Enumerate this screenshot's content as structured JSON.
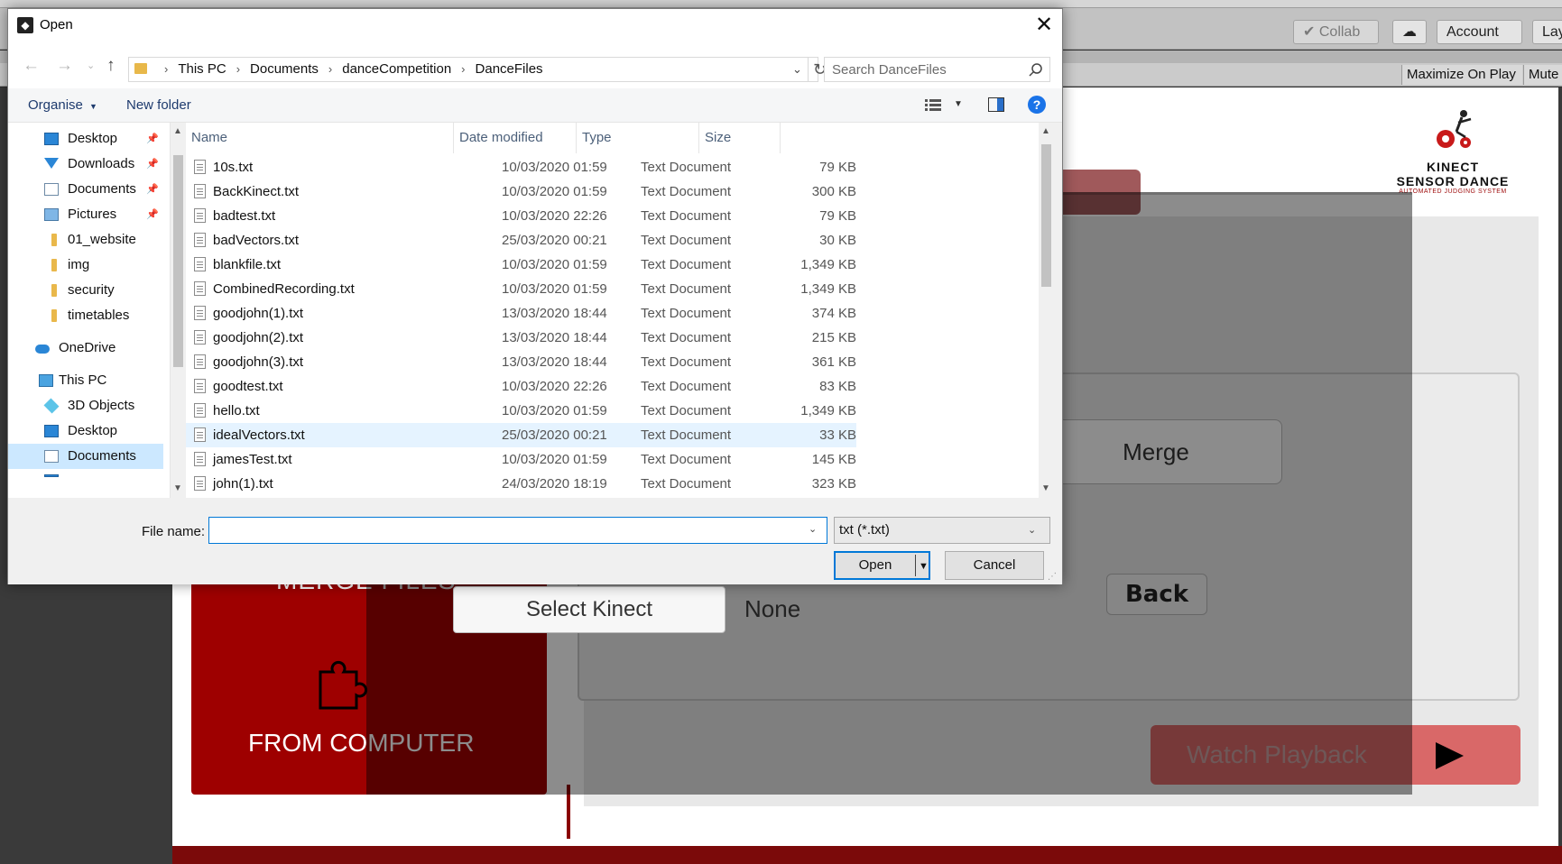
{
  "background": {
    "toolbar": {
      "collab_label": "Collab",
      "account_label": "Account",
      "layout_label": "Lay"
    },
    "game_bar": {
      "maximize_label": "Maximize On Play",
      "mute_label": "Mute"
    },
    "game": {
      "logo_title_line1": "KINECT",
      "logo_title_line2": "SENSOR DANCE",
      "logo_subtitle": "AUTOMATED JUDGING SYSTEM",
      "merge_button": "Merge",
      "back_button": "Back",
      "select_kinect_button": "Select Kinect",
      "select_kinect_value": "None",
      "merge_files_label": "MERGE FILES",
      "from_computer_label": "FROM COMPUTER",
      "watch_playback_button": "Watch Playback"
    }
  },
  "dialog": {
    "title": "Open",
    "breadcrumb": [
      "This PC",
      "Documents",
      "danceCompetition",
      "DanceFiles"
    ],
    "search_placeholder": "Search DanceFiles",
    "commands": {
      "organise_label": "Organise",
      "new_folder_label": "New folder"
    },
    "nav_items": [
      {
        "label": "Desktop",
        "icon": "desktop-icon",
        "pinned": true
      },
      {
        "label": "Downloads",
        "icon": "download-icon",
        "pinned": true
      },
      {
        "label": "Documents",
        "icon": "documents-icon",
        "pinned": true
      },
      {
        "label": "Pictures",
        "icon": "pictures-icon",
        "pinned": true
      },
      {
        "label": "01_website",
        "icon": "folder-icon",
        "pinned": false
      },
      {
        "label": "img",
        "icon": "folder-icon",
        "pinned": false
      },
      {
        "label": "security",
        "icon": "folder-icon",
        "pinned": false
      },
      {
        "label": "timetables",
        "icon": "folder-icon",
        "pinned": false
      },
      {
        "label": "OneDrive",
        "icon": "onedrive-icon",
        "pinned": false
      },
      {
        "label": "This PC",
        "icon": "this-pc-icon",
        "pinned": false
      },
      {
        "label": "3D Objects",
        "icon": "3d-objects-icon",
        "pinned": false
      },
      {
        "label": "Desktop",
        "icon": "desktop-icon",
        "pinned": false
      },
      {
        "label": "Documents",
        "icon": "documents-icon",
        "pinned": false,
        "selected": true
      }
    ],
    "columns": {
      "name": "Name",
      "date": "Date modified",
      "type": "Type",
      "size": "Size"
    },
    "files": [
      {
        "name": "10s.txt",
        "date": "10/03/2020 01:59",
        "type": "Text Document",
        "size": "79 KB"
      },
      {
        "name": "BackKinect.txt",
        "date": "10/03/2020 01:59",
        "type": "Text Document",
        "size": "300 KB"
      },
      {
        "name": "badtest.txt",
        "date": "10/03/2020 22:26",
        "type": "Text Document",
        "size": "79 KB"
      },
      {
        "name": "badVectors.txt",
        "date": "25/03/2020 00:21",
        "type": "Text Document",
        "size": "30 KB"
      },
      {
        "name": "blankfile.txt",
        "date": "10/03/2020 01:59",
        "type": "Text Document",
        "size": "1,349 KB"
      },
      {
        "name": "CombinedRecording.txt",
        "date": "10/03/2020 01:59",
        "type": "Text Document",
        "size": "1,349 KB"
      },
      {
        "name": "goodjohn(1).txt",
        "date": "13/03/2020 18:44",
        "type": "Text Document",
        "size": "374 KB"
      },
      {
        "name": "goodjohn(2).txt",
        "date": "13/03/2020 18:44",
        "type": "Text Document",
        "size": "215 KB"
      },
      {
        "name": "goodjohn(3).txt",
        "date": "13/03/2020 18:44",
        "type": "Text Document",
        "size": "361 KB"
      },
      {
        "name": "goodtest.txt",
        "date": "10/03/2020 22:26",
        "type": "Text Document",
        "size": "83 KB"
      },
      {
        "name": "hello.txt",
        "date": "10/03/2020 01:59",
        "type": "Text Document",
        "size": "1,349 KB"
      },
      {
        "name": "idealVectors.txt",
        "date": "25/03/2020 00:21",
        "type": "Text Document",
        "size": "33 KB",
        "selected": true
      },
      {
        "name": "jamesTest.txt",
        "date": "10/03/2020 01:59",
        "type": "Text Document",
        "size": "145 KB"
      },
      {
        "name": "john(1).txt",
        "date": "24/03/2020 18:19",
        "type": "Text Document",
        "size": "323 KB"
      }
    ],
    "filename_label": "File name:",
    "filename_value": "",
    "filetype_value": "txt (*.txt)",
    "open_label": "Open",
    "cancel_label": "Cancel",
    "colors": {
      "accent": "#0078d7",
      "selection": "#cce8ff",
      "hover_row": "#e5f3ff"
    }
  }
}
